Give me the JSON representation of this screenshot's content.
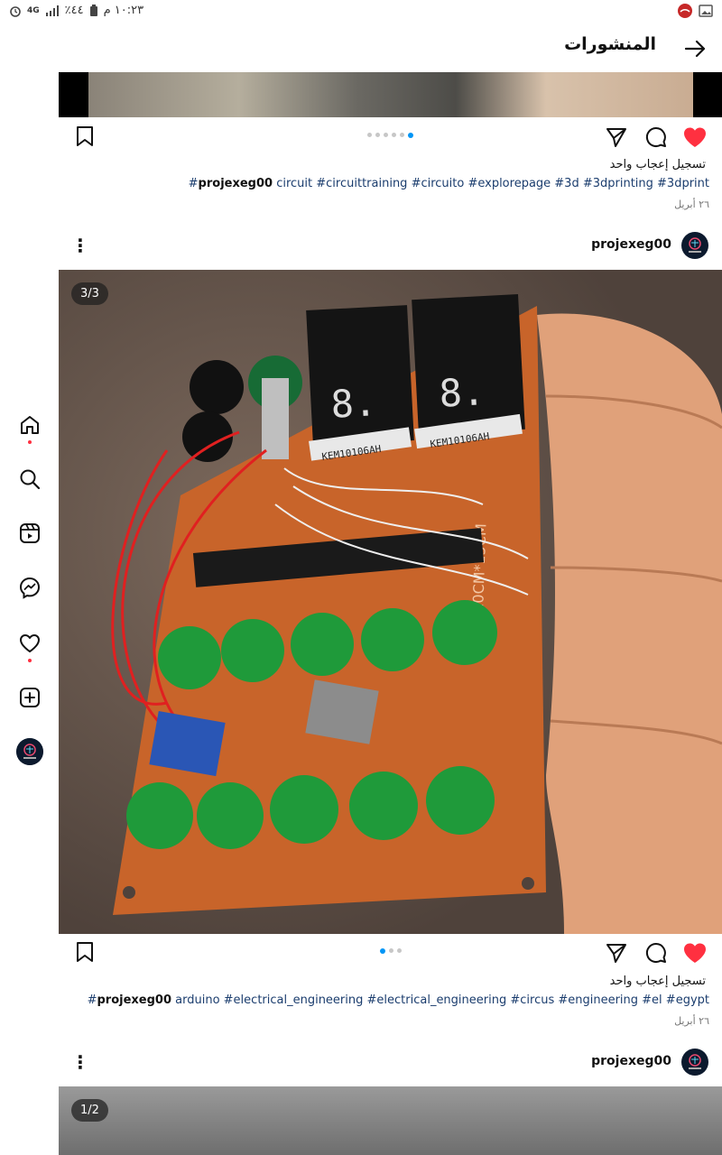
{
  "status_bar": {
    "time": "١٠:٢٣ م",
    "battery": "٪٤٤",
    "network": "4G"
  },
  "header": {
    "title": "المنشورات"
  },
  "rail": {
    "items": [
      "home-icon",
      "search-icon",
      "reels-icon",
      "messenger-icon",
      "activity-heart-icon",
      "create-plus-icon",
      "profile-avatar"
    ]
  },
  "posts": [
    {
      "likes": "تسجيل إعجاب واحد",
      "caption_user": "projexeg00",
      "caption_tags": "circuit #circuittraining #circuito #explorepage #3d #3dprinting #3dprint#",
      "date": "٢٦ أبريل",
      "dots": 6,
      "active_dot": 5
    },
    {
      "username": "projexeg00",
      "counter": "3/3",
      "likes": "تسجيل إعجاب واحد",
      "caption_user": "projexeg00",
      "caption_tags": "arduino #electrical_engineering #electrical_engineering #circus #engineering #el #egypt#",
      "date": "٢٦ أبريل",
      "dots": 3,
      "active_dot": 0,
      "image_labels": {
        "pcb_size": "10CM*15CM",
        "display_chip_1": "KEM10106AH",
        "display_chip_2": "KEM10106AH"
      }
    },
    {
      "username": "projexeg00",
      "counter": "1/2"
    }
  ],
  "colors": {
    "heart": "#ff3040",
    "dot_active": "#0095f6",
    "pcb": "#c8642a",
    "button_green": "#1f9a3a"
  }
}
